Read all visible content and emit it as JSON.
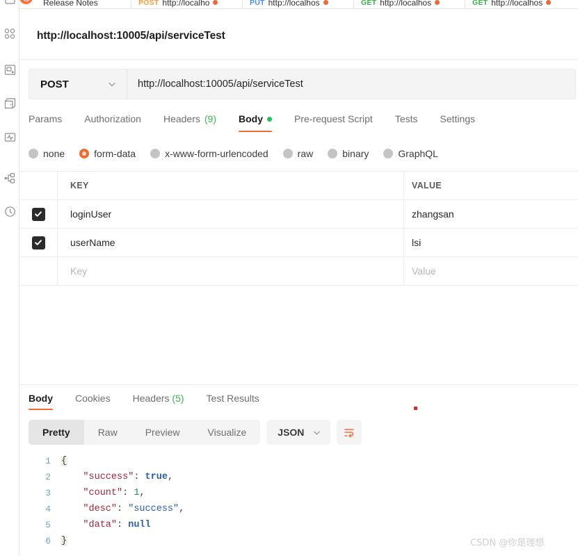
{
  "sidebar": {
    "items": [
      {
        "name": "collections-icon",
        "label": "Collections"
      },
      {
        "name": "apis-icon",
        "label": "APIs"
      },
      {
        "name": "environments-icon",
        "label": "Environments"
      },
      {
        "name": "mock-servers-icon",
        "label": "Mock Servers"
      },
      {
        "name": "monitors-icon",
        "label": "Monitors"
      },
      {
        "name": "flows-icon",
        "label": "Flows"
      },
      {
        "name": "history-icon",
        "label": "History"
      }
    ]
  },
  "tabstrip": {
    "release_notes": "Release Notes",
    "tabs": [
      {
        "method": "POST",
        "url": "http://localho",
        "dirty": true
      },
      {
        "method": "PUT",
        "url": "http://localhos",
        "dirty": true
      },
      {
        "method": "GET",
        "url": "http://localhos",
        "dirty": true
      },
      {
        "method": "GET",
        "url": "http://localhos",
        "dirty": true
      }
    ]
  },
  "request": {
    "title": "http://localhost:10005/api/serviceTest",
    "method": "POST",
    "url": "http://localhost:10005/api/serviceTest",
    "tabs": [
      {
        "label": "Params",
        "count": "",
        "dot": false,
        "active": false
      },
      {
        "label": "Authorization",
        "count": "",
        "dot": false,
        "active": false
      },
      {
        "label": "Headers",
        "count": "(9)",
        "dot": false,
        "active": false
      },
      {
        "label": "Body",
        "count": "",
        "dot": true,
        "active": true
      },
      {
        "label": "Pre-request Script",
        "count": "",
        "dot": false,
        "active": false
      },
      {
        "label": "Tests",
        "count": "",
        "dot": false,
        "active": false
      },
      {
        "label": "Settings",
        "count": "",
        "dot": false,
        "active": false
      }
    ],
    "body_types": [
      {
        "label": "none",
        "selected": false
      },
      {
        "label": "form-data",
        "selected": true
      },
      {
        "label": "x-www-form-urlencoded",
        "selected": false
      },
      {
        "label": "raw",
        "selected": false
      },
      {
        "label": "binary",
        "selected": false
      },
      {
        "label": "GraphQL",
        "selected": false
      }
    ],
    "table": {
      "headers": {
        "key": "KEY",
        "value": "VALUE"
      },
      "rows": [
        {
          "checked": true,
          "key": "loginUser",
          "value": "zhangsan"
        },
        {
          "checked": true,
          "key": "userName",
          "value": "lsi"
        }
      ],
      "new_row": {
        "key_placeholder": "Key",
        "value_placeholder": "Value"
      }
    }
  },
  "response": {
    "tabs": [
      {
        "label": "Body",
        "count": "",
        "active": true
      },
      {
        "label": "Cookies",
        "count": "",
        "active": false
      },
      {
        "label": "Headers",
        "count": "(5)",
        "active": false
      },
      {
        "label": "Test Results",
        "count": "",
        "active": false
      }
    ],
    "format_buttons": [
      {
        "label": "Pretty",
        "active": true
      },
      {
        "label": "Raw",
        "active": false
      },
      {
        "label": "Preview",
        "active": false
      },
      {
        "label": "Visualize",
        "active": false
      }
    ],
    "language": "JSON",
    "wrap_icon": "wrap-lines-icon",
    "body_lines": [
      {
        "n": "1",
        "tokens": [
          {
            "t": "brace",
            "v": "{"
          }
        ]
      },
      {
        "n": "2",
        "tokens": [
          {
            "t": "plain",
            "v": "    "
          },
          {
            "t": "key",
            "v": "\"success\""
          },
          {
            "t": "punc",
            "v": ": "
          },
          {
            "t": "kw",
            "v": "true"
          },
          {
            "t": "punc",
            "v": ","
          }
        ]
      },
      {
        "n": "3",
        "tokens": [
          {
            "t": "plain",
            "v": "    "
          },
          {
            "t": "key",
            "v": "\"count\""
          },
          {
            "t": "punc",
            "v": ": "
          },
          {
            "t": "num",
            "v": "1"
          },
          {
            "t": "punc",
            "v": ","
          }
        ]
      },
      {
        "n": "4",
        "tokens": [
          {
            "t": "plain",
            "v": "    "
          },
          {
            "t": "key",
            "v": "\"desc\""
          },
          {
            "t": "punc",
            "v": ": "
          },
          {
            "t": "str",
            "v": "\"success\""
          },
          {
            "t": "punc",
            "v": ","
          }
        ]
      },
      {
        "n": "5",
        "tokens": [
          {
            "t": "plain",
            "v": "    "
          },
          {
            "t": "key",
            "v": "\"data\""
          },
          {
            "t": "punc",
            "v": ": "
          },
          {
            "t": "kw",
            "v": "null"
          }
        ]
      },
      {
        "n": "6",
        "tokens": [
          {
            "t": "brace",
            "v": "}"
          }
        ]
      }
    ]
  },
  "watermark": "CSDN @你是理想",
  "colors": {
    "accent": "#f26b3a",
    "green": "#3bb54a",
    "method_post": "#ff9d3f",
    "method_put": "#4b8df8",
    "method_get": "#3bb54a",
    "dirty_dot": "#f2663c"
  }
}
